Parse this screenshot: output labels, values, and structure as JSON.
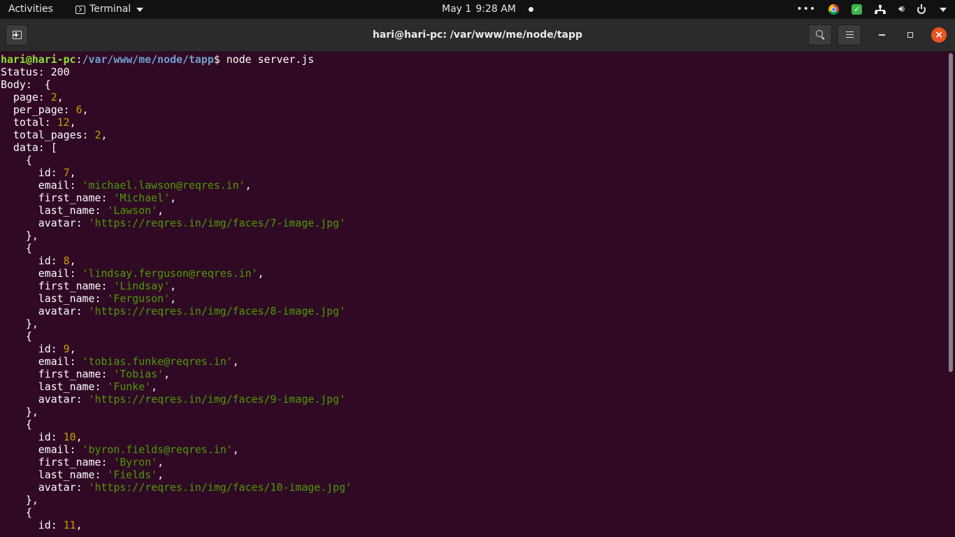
{
  "topbar": {
    "activities": "Activities",
    "app_name": "Terminal",
    "clock": {
      "date": "May 1",
      "time": "9:28 AM"
    }
  },
  "window": {
    "title": "hari@hari-pc: /var/www/me/node/tapp"
  },
  "terminal": {
    "prompt": {
      "user_host": "hari@hari-pc",
      "sep": ":",
      "path": "/var/www/me/node/tapp",
      "symbol": "$",
      "command": " node server.js"
    },
    "lines": [
      [
        {
          "t": "Status: 200",
          "c": ""
        }
      ],
      [
        {
          "t": "Body:  {",
          "c": ""
        }
      ],
      [
        {
          "t": "  page: ",
          "c": ""
        },
        {
          "t": "2",
          "c": "num"
        },
        {
          "t": ",",
          "c": ""
        }
      ],
      [
        {
          "t": "  per_page: ",
          "c": ""
        },
        {
          "t": "6",
          "c": "num"
        },
        {
          "t": ",",
          "c": ""
        }
      ],
      [
        {
          "t": "  total: ",
          "c": ""
        },
        {
          "t": "12",
          "c": "num"
        },
        {
          "t": ",",
          "c": ""
        }
      ],
      [
        {
          "t": "  total_pages: ",
          "c": ""
        },
        {
          "t": "2",
          "c": "num"
        },
        {
          "t": ",",
          "c": ""
        }
      ],
      [
        {
          "t": "  data: [",
          "c": ""
        }
      ],
      [
        {
          "t": "    {",
          "c": ""
        }
      ],
      [
        {
          "t": "      id: ",
          "c": ""
        },
        {
          "t": "7",
          "c": "num"
        },
        {
          "t": ",",
          "c": ""
        }
      ],
      [
        {
          "t": "      email: ",
          "c": ""
        },
        {
          "t": "'michael.lawson@reqres.in'",
          "c": "str"
        },
        {
          "t": ",",
          "c": ""
        }
      ],
      [
        {
          "t": "      first_name: ",
          "c": ""
        },
        {
          "t": "'Michael'",
          "c": "str"
        },
        {
          "t": ",",
          "c": ""
        }
      ],
      [
        {
          "t": "      last_name: ",
          "c": ""
        },
        {
          "t": "'Lawson'",
          "c": "str"
        },
        {
          "t": ",",
          "c": ""
        }
      ],
      [
        {
          "t": "      avatar: ",
          "c": ""
        },
        {
          "t": "'https://reqres.in/img/faces/7-image.jpg'",
          "c": "str"
        }
      ],
      [
        {
          "t": "    },",
          "c": ""
        }
      ],
      [
        {
          "t": "    {",
          "c": ""
        }
      ],
      [
        {
          "t": "      id: ",
          "c": ""
        },
        {
          "t": "8",
          "c": "num"
        },
        {
          "t": ",",
          "c": ""
        }
      ],
      [
        {
          "t": "      email: ",
          "c": ""
        },
        {
          "t": "'lindsay.ferguson@reqres.in'",
          "c": "str"
        },
        {
          "t": ",",
          "c": ""
        }
      ],
      [
        {
          "t": "      first_name: ",
          "c": ""
        },
        {
          "t": "'Lindsay'",
          "c": "str"
        },
        {
          "t": ",",
          "c": ""
        }
      ],
      [
        {
          "t": "      last_name: ",
          "c": ""
        },
        {
          "t": "'Ferguson'",
          "c": "str"
        },
        {
          "t": ",",
          "c": ""
        }
      ],
      [
        {
          "t": "      avatar: ",
          "c": ""
        },
        {
          "t": "'https://reqres.in/img/faces/8-image.jpg'",
          "c": "str"
        }
      ],
      [
        {
          "t": "    },",
          "c": ""
        }
      ],
      [
        {
          "t": "    {",
          "c": ""
        }
      ],
      [
        {
          "t": "      id: ",
          "c": ""
        },
        {
          "t": "9",
          "c": "num"
        },
        {
          "t": ",",
          "c": ""
        }
      ],
      [
        {
          "t": "      email: ",
          "c": ""
        },
        {
          "t": "'tobias.funke@reqres.in'",
          "c": "str"
        },
        {
          "t": ",",
          "c": ""
        }
      ],
      [
        {
          "t": "      first_name: ",
          "c": ""
        },
        {
          "t": "'Tobias'",
          "c": "str"
        },
        {
          "t": ",",
          "c": ""
        }
      ],
      [
        {
          "t": "      last_name: ",
          "c": ""
        },
        {
          "t": "'Funke'",
          "c": "str"
        },
        {
          "t": ",",
          "c": ""
        }
      ],
      [
        {
          "t": "      avatar: ",
          "c": ""
        },
        {
          "t": "'https://reqres.in/img/faces/9-image.jpg'",
          "c": "str"
        }
      ],
      [
        {
          "t": "    },",
          "c": ""
        }
      ],
      [
        {
          "t": "    {",
          "c": ""
        }
      ],
      [
        {
          "t": "      id: ",
          "c": ""
        },
        {
          "t": "10",
          "c": "num"
        },
        {
          "t": ",",
          "c": ""
        }
      ],
      [
        {
          "t": "      email: ",
          "c": ""
        },
        {
          "t": "'byron.fields@reqres.in'",
          "c": "str"
        },
        {
          "t": ",",
          "c": ""
        }
      ],
      [
        {
          "t": "      first_name: ",
          "c": ""
        },
        {
          "t": "'Byron'",
          "c": "str"
        },
        {
          "t": ",",
          "c": ""
        }
      ],
      [
        {
          "t": "      last_name: ",
          "c": ""
        },
        {
          "t": "'Fields'",
          "c": "str"
        },
        {
          "t": ",",
          "c": ""
        }
      ],
      [
        {
          "t": "      avatar: ",
          "c": ""
        },
        {
          "t": "'https://reqres.in/img/faces/10-image.jpg'",
          "c": "str"
        }
      ],
      [
        {
          "t": "    },",
          "c": ""
        }
      ],
      [
        {
          "t": "    {",
          "c": ""
        }
      ],
      [
        {
          "t": "      id: ",
          "c": ""
        },
        {
          "t": "11",
          "c": "num"
        },
        {
          "t": ",",
          "c": ""
        }
      ]
    ]
  },
  "colors": {
    "terminal_bg": "#300a24",
    "user_host": "#8ae234",
    "path": "#729fcf",
    "number": "#c4a000",
    "string": "#4e9a06",
    "close_button": "#e95420"
  },
  "icons": [
    "terminal-icon",
    "chevron-down-icon",
    "recording-dot-icon",
    "more-icon",
    "chrome-icon",
    "shield-icon",
    "network-icon",
    "volume-icon",
    "power-icon",
    "new-tab-icon",
    "search-icon",
    "hamburger-menu-icon",
    "minimize-icon",
    "maximize-icon",
    "close-icon"
  ]
}
